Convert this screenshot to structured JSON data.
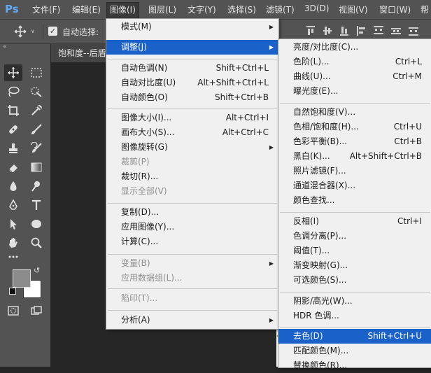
{
  "menubar": {
    "logo": "Ps",
    "items": [
      "文件(F)",
      "编辑(E)",
      "图像(I)",
      "图层(L)",
      "文字(Y)",
      "选择(S)",
      "滤镜(T)",
      "3D(D)",
      "视图(V)",
      "窗口(W)",
      "帮"
    ]
  },
  "options": {
    "auto_select_label": "自动选择:"
  },
  "document": {
    "tab_title": "饱和度--后盾"
  },
  "image_menu": [
    {
      "label": "模式(M)",
      "submenu": true
    },
    {
      "label": "调整(J)",
      "submenu": true,
      "highlighted": true
    },
    {
      "label": "自动色调(N)",
      "shortcut": "Shift+Ctrl+L"
    },
    {
      "label": "自动对比度(U)",
      "shortcut": "Alt+Shift+Ctrl+L"
    },
    {
      "label": "自动颜色(O)",
      "shortcut": "Shift+Ctrl+B"
    },
    {
      "label": "图像大小(I)...",
      "shortcut": "Alt+Ctrl+I"
    },
    {
      "label": "画布大小(S)...",
      "shortcut": "Alt+Ctrl+C"
    },
    {
      "label": "图像旋转(G)",
      "submenu": true
    },
    {
      "label": "裁剪(P)",
      "disabled": true
    },
    {
      "label": "裁切(R)..."
    },
    {
      "label": "显示全部(V)",
      "disabled": true
    },
    {
      "label": "复制(D)..."
    },
    {
      "label": "应用图像(Y)..."
    },
    {
      "label": "计算(C)..."
    },
    {
      "label": "变量(B)",
      "submenu": true,
      "disabled": true
    },
    {
      "label": "应用数据组(L)...",
      "disabled": true
    },
    {
      "label": "陷印(T)...",
      "disabled": true
    },
    {
      "label": "分析(A)",
      "submenu": true
    }
  ],
  "adjust_menu": [
    {
      "label": "亮度/对比度(C)..."
    },
    {
      "label": "色阶(L)...",
      "shortcut": "Ctrl+L"
    },
    {
      "label": "曲线(U)...",
      "shortcut": "Ctrl+M"
    },
    {
      "label": "曝光度(E)..."
    },
    {
      "label": "自然饱和度(V)..."
    },
    {
      "label": "色相/饱和度(H)...",
      "shortcut": "Ctrl+U"
    },
    {
      "label": "色彩平衡(B)...",
      "shortcut": "Ctrl+B"
    },
    {
      "label": "黑白(K)...",
      "shortcut": "Alt+Shift+Ctrl+B"
    },
    {
      "label": "照片滤镜(F)..."
    },
    {
      "label": "通道混合器(X)..."
    },
    {
      "label": "颜色查找..."
    },
    {
      "label": "反相(I)",
      "shortcut": "Ctrl+I"
    },
    {
      "label": "色调分离(P)..."
    },
    {
      "label": "阈值(T)..."
    },
    {
      "label": "渐变映射(G)..."
    },
    {
      "label": "可选颜色(S)..."
    },
    {
      "label": "阴影/高光(W)..."
    },
    {
      "label": "HDR 色调..."
    },
    {
      "label": "去色(D)",
      "shortcut": "Shift+Ctrl+U",
      "highlighted": true
    },
    {
      "label": "匹配颜色(M)..."
    },
    {
      "label": "替换颜色(R)..."
    }
  ],
  "colors": {
    "highlight": "#1a62c9",
    "menu_bg": "#f0f0f0",
    "app_bg": "#535353"
  }
}
